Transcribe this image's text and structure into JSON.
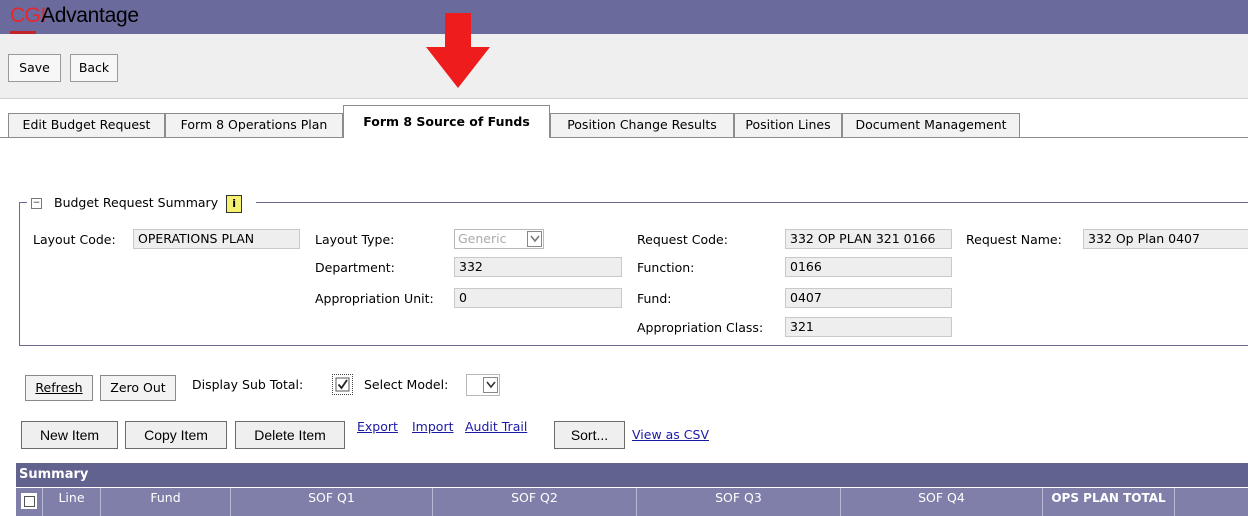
{
  "app": {
    "logo_prefix": "CGI",
    "logo_suffix": "Advantage",
    "brand_color": "#e8262c",
    "header_color": "#6a6a9c"
  },
  "toolbar": {
    "save_label": "Save",
    "back_label": "Back"
  },
  "tabs": [
    {
      "label": "Edit Budget Request",
      "active": false
    },
    {
      "label": "Form 8 Operations Plan",
      "active": false
    },
    {
      "label": "Form 8 Source of Funds",
      "active": true
    },
    {
      "label": "Position Change Results",
      "active": false
    },
    {
      "label": "Position Lines",
      "active": false
    },
    {
      "label": "Document Management",
      "active": false
    }
  ],
  "summary_section": {
    "title": "Budget Request Summary",
    "layout_code_label": "Layout Code:",
    "layout_code": "OPERATIONS PLAN",
    "layout_type_label": "Layout Type:",
    "layout_type": "Generic",
    "department_label": "Department:",
    "department": "332",
    "appropriation_unit_label": "Appropriation Unit:",
    "appropriation_unit": "0",
    "request_code_label": "Request Code:",
    "request_code": "332 OP PLAN 321 0166",
    "request_name_label": "Request Name:",
    "request_name": "332 Op Plan 0407",
    "function_label": "Function:",
    "function": "0166",
    "fund_label": "Fund:",
    "fund": "0407",
    "appropriation_class_label": "Appropriation Class:",
    "appropriation_class": "321"
  },
  "actions": {
    "refresh_label": "Refresh",
    "zero_out_label": "Zero Out",
    "display_sub_total_label": "Display Sub Total:",
    "display_sub_total_checked": true,
    "select_model_label": "Select Model:",
    "select_model_value": "",
    "new_item_label": "New Item",
    "copy_item_label": "Copy Item",
    "delete_item_label": "Delete Item",
    "export_label": "Export",
    "import_label": "Import",
    "audit_trail_label": "Audit Trail",
    "sort_label": "Sort...",
    "view_csv_label": "View as CSV"
  },
  "grid": {
    "section_title": "Summary",
    "columns": [
      "Line",
      "Fund",
      "SOF Q1",
      "SOF Q2",
      "SOF Q3",
      "SOF Q4",
      "OPS PLAN TOTAL"
    ]
  },
  "icons": {
    "annotation_arrow": "red-down-arrow-icon",
    "info": "info-icon",
    "collapse": "minus-icon",
    "dropdown": "chevron-down-icon"
  }
}
